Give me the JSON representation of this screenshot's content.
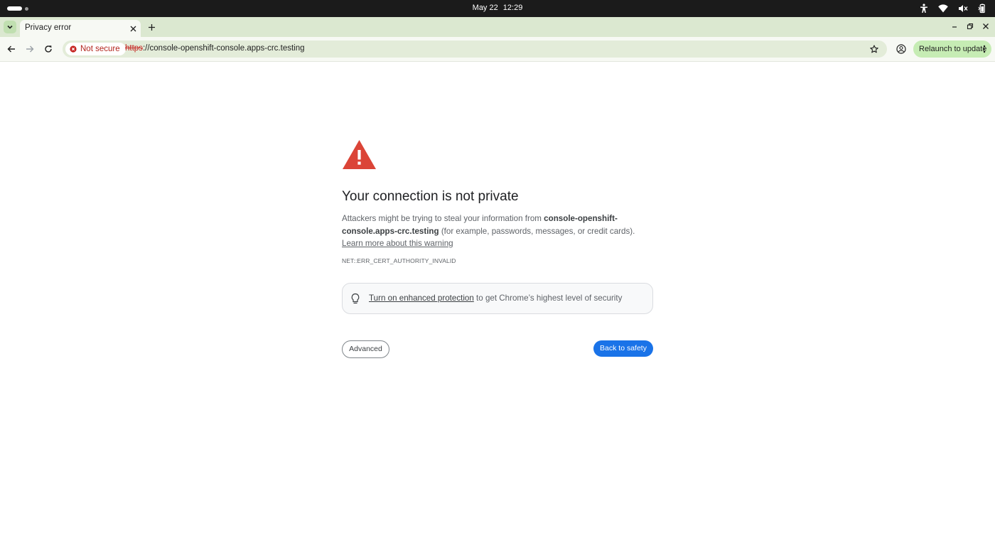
{
  "system_bar": {
    "date": "May 22",
    "time": "12:29",
    "icons": [
      "activities-indicator",
      "accessibility-icon",
      "wifi-icon",
      "volume-muted-icon",
      "battery-icon"
    ]
  },
  "tabs": [
    {
      "title": "Privacy error",
      "active": true
    }
  ],
  "toolbar": {
    "security_chip": "Not secure",
    "url_scheme": "https",
    "url_rest": "://console-openshift-console.apps-crc.testing",
    "relaunch_label": "Relaunch to update"
  },
  "interstitial": {
    "headline": "Your connection is not private",
    "explain_prefix": "Attackers might be trying to steal your information from ",
    "host": "console-openshift-console.apps-crc.testing",
    "explain_suffix": " (for example, passwords, messages, or credit cards). ",
    "learn_more": "Learn more about this warning",
    "error_code": "NET::ERR_CERT_AUTHORITY_INVALID",
    "protection_link": "Turn on enhanced protection",
    "protection_suffix": " to get Chrome’s highest level of security",
    "advanced_label": "Advanced",
    "back_label": "Back to safety"
  },
  "colors": {
    "warning_red": "#db4437",
    "primary_blue": "#1a73e8",
    "not_secure_red": "#b3261e",
    "tabstrip_green": "#dbe8d0",
    "relaunch_green": "#c6ecb4"
  }
}
